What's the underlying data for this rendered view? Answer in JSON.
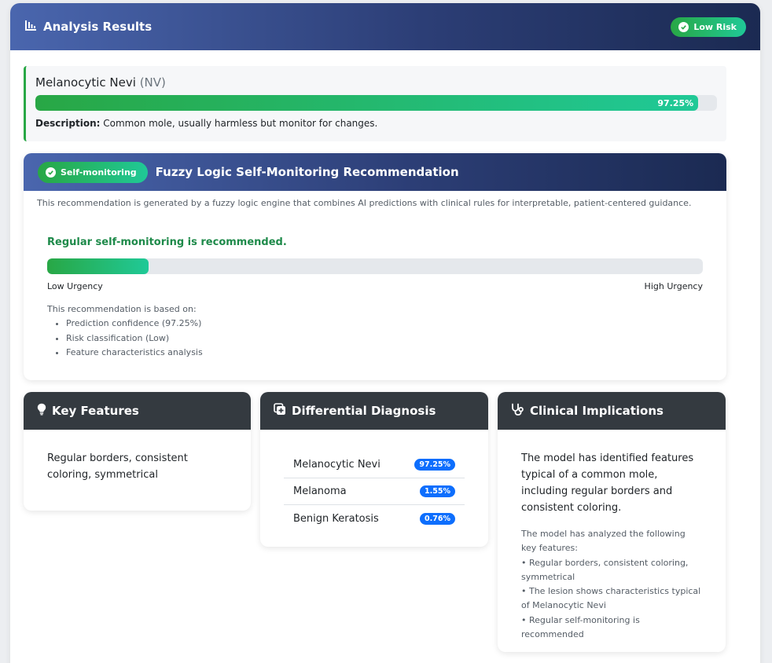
{
  "header": {
    "title": "Analysis Results",
    "risk_badge": "Low Risk"
  },
  "prediction": {
    "name": "Melanocytic Nevi",
    "abbr": "(NV)",
    "confidence_label": "97.25%",
    "confidence_value": 97.25,
    "description_label": "Description:",
    "description": "Common mole, usually harmless but monitor for changes."
  },
  "fuzzy": {
    "badge": "Self-monitoring",
    "title": "Fuzzy Logic Self-Monitoring Recommendation",
    "intro": "This recommendation is generated by a fuzzy logic engine that combines AI predictions with clinical rules for interpretable, patient-centered guidance.",
    "recommendation": "Regular self-monitoring is recommended.",
    "urgency_level": 0.155,
    "low_label": "Low Urgency",
    "high_label": "High Urgency",
    "basis_intro": "This recommendation is based on:",
    "basis_items": [
      "Prediction confidence (97.25%)",
      "Risk classification (Low)",
      "Feature characteristics analysis"
    ]
  },
  "key_features": {
    "title": "Key Features",
    "text": "Regular borders, consistent coloring, symmetrical"
  },
  "differential": {
    "title": "Differential Diagnosis",
    "rows": [
      {
        "name": "Melanocytic Nevi",
        "value": "97.25%"
      },
      {
        "name": "Melanoma",
        "value": "1.55%"
      },
      {
        "name": "Benign Keratosis",
        "value": "0.76%"
      }
    ]
  },
  "clinical": {
    "title": "Clinical Implications",
    "main": "The model has identified features typical of a common mole, including regular borders and consistent coloring.",
    "sub_intro": "The model has analyzed the following key features:",
    "sub_items": [
      "• Regular borders, consistent coloring, symmetrical",
      "• The lesion shows characteristics typical of Melanocytic Nevi",
      "• Regular self-monitoring is recommended"
    ]
  },
  "colors": {
    "header_gradient_start": "#4a66ae",
    "header_gradient_end": "#1b2a52",
    "success": "#28a745",
    "teal": "#20c997",
    "badge_blue": "#0d6efd",
    "dark_header": "#343a40",
    "recommendation_green": "#1e8a4a"
  },
  "icons": {
    "results": "bar-chart-icon",
    "check": "check-circle-icon",
    "key_features": "lightbulb-icon",
    "differential": "plus-square-icon",
    "clinical": "stethoscope-icon"
  }
}
